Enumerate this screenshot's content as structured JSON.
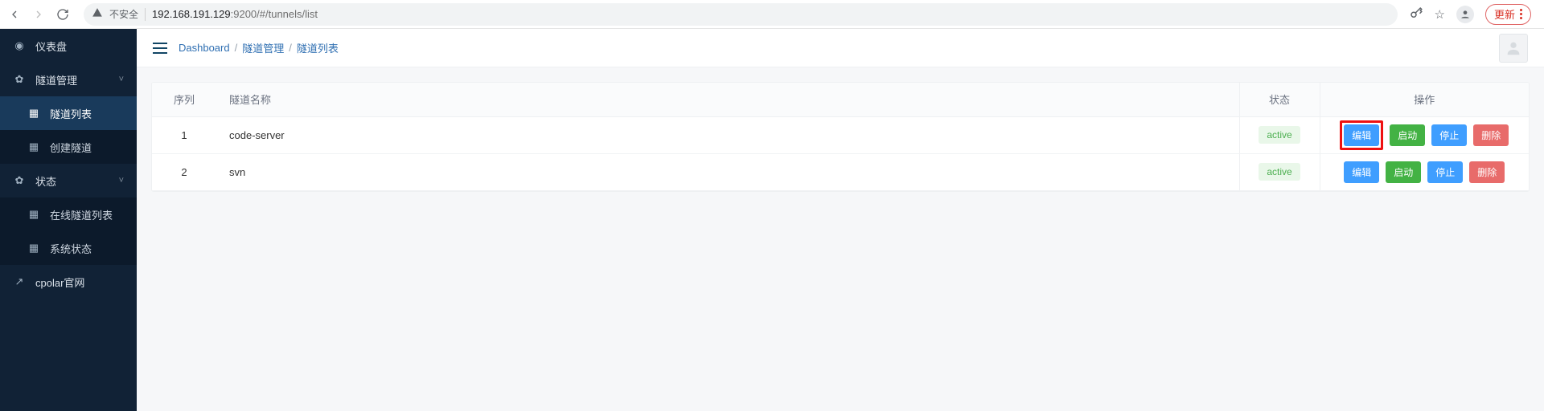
{
  "browser": {
    "insecure_label": "不安全",
    "url_host": "192.168.191.129",
    "url_port_path": ":9200/#/tunnels/list",
    "update_label": "更新"
  },
  "sidebar": {
    "items": [
      {
        "label": "仪表盘",
        "icon": "◉",
        "kind": "top",
        "active": false,
        "expandable": false
      },
      {
        "label": "隧道管理",
        "icon": "✿",
        "kind": "top",
        "active": false,
        "expandable": true
      },
      {
        "label": "隧道列表",
        "icon": "▦",
        "kind": "sub",
        "active": true,
        "expandable": false
      },
      {
        "label": "创建隧道",
        "icon": "▦",
        "kind": "sub",
        "active": false,
        "expandable": false
      },
      {
        "label": "状态",
        "icon": "✿",
        "kind": "top",
        "active": false,
        "expandable": true
      },
      {
        "label": "在线隧道列表",
        "icon": "▦",
        "kind": "sub",
        "active": false,
        "expandable": false
      },
      {
        "label": "系统状态",
        "icon": "▦",
        "kind": "sub",
        "active": false,
        "expandable": false
      },
      {
        "label": "cpolar官网",
        "icon": "↗",
        "kind": "top",
        "active": false,
        "expandable": false
      }
    ]
  },
  "breadcrumb": {
    "root": "Dashboard",
    "mid": "隧道管理",
    "current": "隧道列表",
    "sep": "/"
  },
  "table": {
    "headers": {
      "index": "序列",
      "name": "隧道名称",
      "status": "状态",
      "actions": "操作"
    },
    "rows": [
      {
        "index": "1",
        "name": "code-server",
        "status": "active",
        "edit": "编辑",
        "start": "启动",
        "stop": "停止",
        "delete": "删除",
        "highlight_edit": true
      },
      {
        "index": "2",
        "name": "svn",
        "status": "active",
        "edit": "编辑",
        "start": "启动",
        "stop": "停止",
        "delete": "删除",
        "highlight_edit": false
      }
    ]
  }
}
